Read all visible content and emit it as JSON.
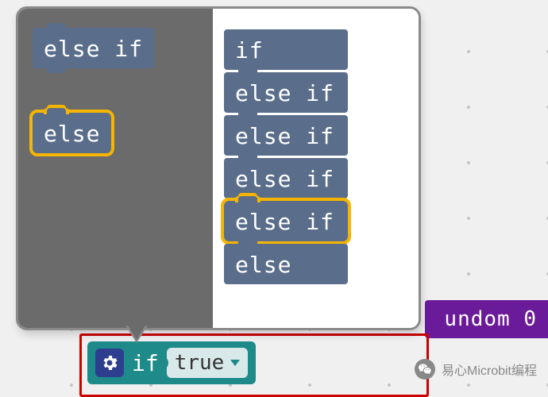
{
  "popup": {
    "palette": {
      "else_if": "else if",
      "else": "else"
    },
    "stack": {
      "items": [
        {
          "label": "if"
        },
        {
          "label": "else if"
        },
        {
          "label": "else if"
        },
        {
          "label": "else if"
        },
        {
          "label": "else if",
          "selected": true
        },
        {
          "label": "else"
        }
      ]
    }
  },
  "if_block": {
    "keyword": "if",
    "value": "true"
  },
  "purple": {
    "label": "undom 0"
  },
  "watermark": {
    "text": "易心Microbit编程"
  }
}
